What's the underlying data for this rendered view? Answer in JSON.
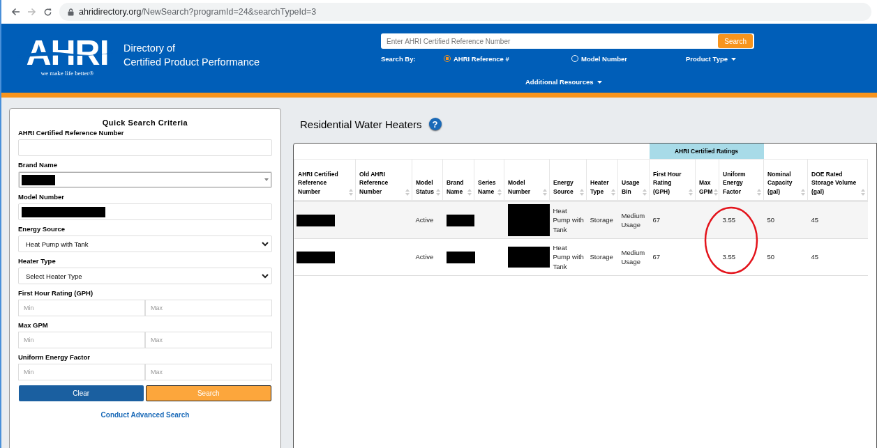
{
  "browser": {
    "url_host": "ahridirectory.org",
    "url_path": "/NewSearch?programId=24&searchTypeId=3"
  },
  "header": {
    "logo": "AHRI",
    "tagline": "we make life better®",
    "title_line1": "Directory of",
    "title_line2": "Certified Product Performance",
    "search": {
      "placeholder": "Enter AHRI Certified Reference Number",
      "button": "Search"
    },
    "search_by": {
      "label": "Search By:",
      "options": [
        {
          "label": "AHRI Reference #",
          "selected": true
        },
        {
          "label": "Model Number",
          "selected": false
        }
      ]
    },
    "menus": [
      "Product Type",
      "Additional Resources"
    ]
  },
  "quick_search": {
    "title": "Quick Search Criteria",
    "fields": [
      {
        "kind": "text",
        "label": "AHRI Certified Reference Number"
      },
      {
        "kind": "combo",
        "label": "Brand Name",
        "redacted": true
      },
      {
        "kind": "text",
        "label": "Model Number",
        "redacted": true
      },
      {
        "kind": "select",
        "label": "Energy Source",
        "value": "Heat Pump with Tank"
      },
      {
        "kind": "select",
        "label": "Heater Type",
        "value": "Select Heater Type"
      },
      {
        "kind": "range",
        "label": "First Hour Rating (GPH)",
        "inputs": [
          {
            "placeholder": "Min"
          },
          {
            "placeholder": "Max"
          }
        ]
      },
      {
        "kind": "range",
        "label": "Max GPM",
        "inputs": [
          {
            "placeholder": "Min"
          },
          {
            "placeholder": "Max"
          }
        ]
      },
      {
        "kind": "range",
        "label": "Uniform Energy Factor",
        "inputs": [
          {
            "placeholder": "Min"
          },
          {
            "placeholder": "Max"
          }
        ]
      }
    ],
    "buttons": [
      "Clear",
      "Search"
    ],
    "link": "Conduct Advanced Search"
  },
  "results": {
    "title": "Residential Water Heaters",
    "help": "?",
    "column_groups": [
      {
        "columns": [
          "AHRI Certified Reference Number",
          "Old AHRI Reference Number",
          "Model Status",
          "Brand Name",
          "Series Name",
          "Model Number",
          "Energy Source",
          "Heater Type",
          "Usage Bin"
        ]
      },
      {
        "label": "AHRI Certified Ratings",
        "columns": [
          "First Hour Rating (GPH)",
          "Max GPM",
          "Uniform Energy Factor"
        ]
      },
      {
        "columns": [
          "Nominal Capacity (gal)",
          "DOE Rated Storage Volume (gal)"
        ]
      }
    ],
    "rows": [
      {
        "cells": [
          {
            "kind": "redacted"
          },
          {
            "kind": "empty"
          },
          {
            "kind": "text",
            "text": "Active"
          },
          {
            "kind": "redacted"
          },
          {
            "kind": "empty"
          },
          {
            "kind": "redacted"
          },
          {
            "kind": "text",
            "text": "Heat Pump with Tank"
          },
          {
            "kind": "text",
            "text": "Storage"
          },
          {
            "kind": "text",
            "text": "Medium Usage"
          },
          {
            "kind": "text",
            "text": "67"
          },
          {
            "kind": "empty"
          },
          {
            "kind": "text",
            "text": "3.55",
            "circled": true
          },
          {
            "kind": "text",
            "text": "50"
          },
          {
            "kind": "text",
            "text": "45"
          }
        ]
      },
      {
        "cells": [
          {
            "kind": "redacted"
          },
          {
            "kind": "empty"
          },
          {
            "kind": "text",
            "text": "Active"
          },
          {
            "kind": "redacted"
          },
          {
            "kind": "empty"
          },
          {
            "kind": "redacted"
          },
          {
            "kind": "text",
            "text": "Heat Pump with Tank"
          },
          {
            "kind": "text",
            "text": "Storage"
          },
          {
            "kind": "text",
            "text": "Medium Usage"
          },
          {
            "kind": "text",
            "text": "67"
          },
          {
            "kind": "empty"
          },
          {
            "kind": "text",
            "text": "3.55"
          },
          {
            "kind": "text",
            "text": "50"
          },
          {
            "kind": "text",
            "text": "45"
          }
        ]
      }
    ]
  }
}
